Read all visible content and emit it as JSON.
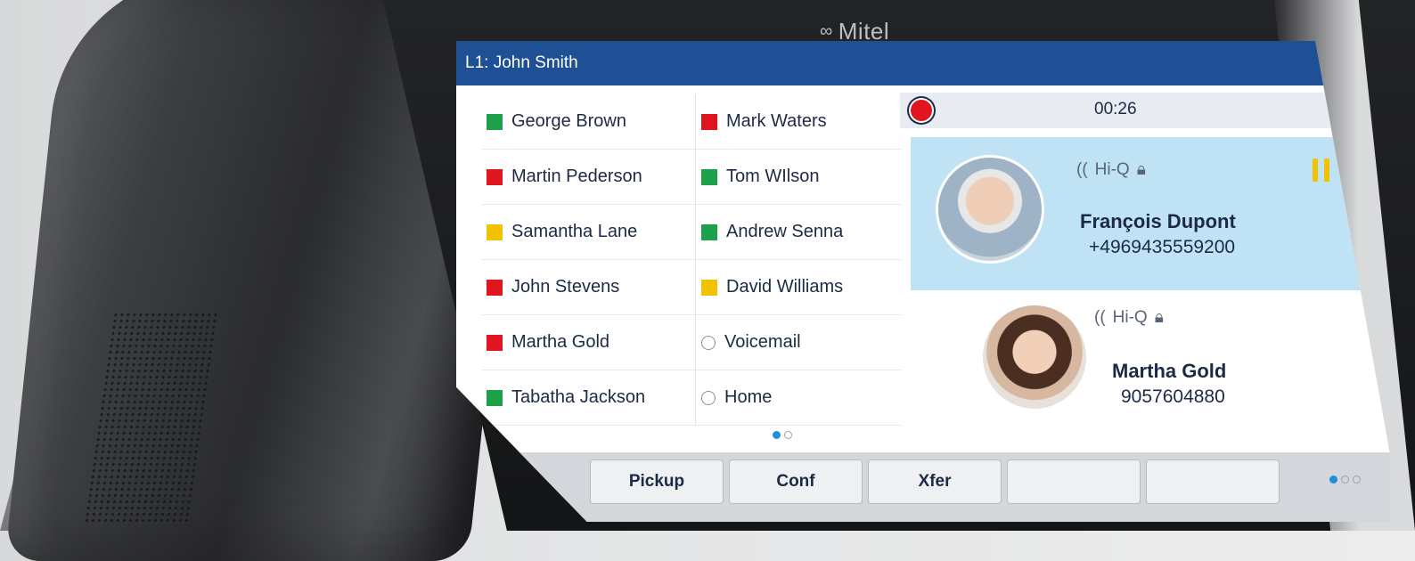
{
  "brand": {
    "name": "Mitel",
    "logo_icon": "mitel-logo-icon"
  },
  "screen": {
    "title": "L1: John Smith",
    "colors": {
      "titlebar": "#1f4f95",
      "active_call": "#bfe3f4",
      "status_green": "#1ea04a",
      "status_red": "#e0151f",
      "status_yellow": "#f2c200",
      "pager_active": "#1e8fd6"
    }
  },
  "contacts_left": [
    {
      "name": "George Brown",
      "status": "green"
    },
    {
      "name": "Martin Pederson",
      "status": "red"
    },
    {
      "name": "Samantha Lane",
      "status": "yellow"
    },
    {
      "name": "John Stevens",
      "status": "red"
    },
    {
      "name": "Martha Gold",
      "status": "red"
    },
    {
      "name": "Tabatha Jackson",
      "status": "green"
    }
  ],
  "contacts_right": [
    {
      "name": "Mark Waters",
      "status": "red"
    },
    {
      "name": "Tom WIlson",
      "status": "green"
    },
    {
      "name": "Andrew Senna",
      "status": "green"
    },
    {
      "name": "David Williams",
      "status": "yellow"
    },
    {
      "name": "Voicemail",
      "status": "none"
    },
    {
      "name": "Home",
      "status": "none"
    }
  ],
  "call_bar": {
    "timer": "00:26",
    "record_icon": "record-icon"
  },
  "calls": [
    {
      "name": "François Dupont",
      "number": "+4969435559200",
      "codec": "Hi-Q",
      "codec_icon": "hiq-audio-icon",
      "lock_icon": "lock-icon",
      "state_icon": "pause-icon"
    },
    {
      "name": "Martha Gold",
      "number": "9057604880",
      "codec": "Hi-Q",
      "codec_icon": "hiq-audio-icon",
      "lock_icon": "lock-icon"
    }
  ],
  "softkeys": [
    "Pickup",
    "Conf",
    "Xfer",
    "",
    "",
    ""
  ],
  "pager": {
    "contacts_pages": 2,
    "contacts_current": 1,
    "softkey_pages": 3,
    "softkey_current": 1
  }
}
